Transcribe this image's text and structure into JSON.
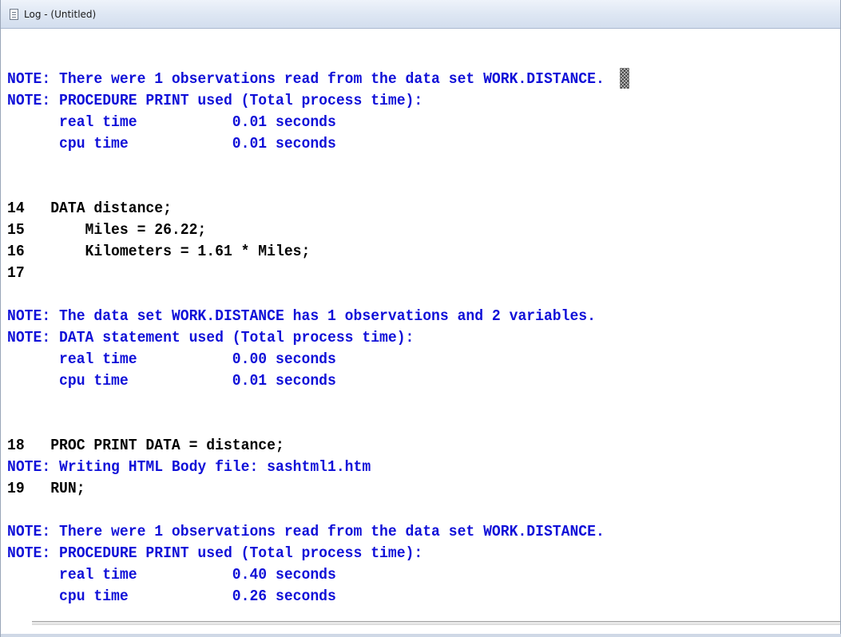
{
  "window": {
    "title": "Log - (Untitled)",
    "icon": "document-icon"
  },
  "colors": {
    "note": "#1010d8",
    "source": "#000000"
  },
  "log": {
    "lines": [
      {
        "kind": "blank",
        "text": ""
      },
      {
        "kind": "note",
        "text": "NOTE: There were 1 observations read from the data set WORK.DISTANCE."
      },
      {
        "kind": "note",
        "text": "NOTE: PROCEDURE PRINT used (Total process time):"
      },
      {
        "kind": "note",
        "text": "      real time           0.01 seconds"
      },
      {
        "kind": "note",
        "text": "      cpu time            0.01 seconds"
      },
      {
        "kind": "blank",
        "text": ""
      },
      {
        "kind": "blank",
        "text": ""
      },
      {
        "kind": "source",
        "text": "14   DATA distance;"
      },
      {
        "kind": "source",
        "text": "15       Miles = 26.22;"
      },
      {
        "kind": "source",
        "text": "16       Kilometers = 1.61 * Miles;"
      },
      {
        "kind": "source",
        "text": "17"
      },
      {
        "kind": "blank",
        "text": ""
      },
      {
        "kind": "note",
        "text": "NOTE: The data set WORK.DISTANCE has 1 observations and 2 variables."
      },
      {
        "kind": "note",
        "text": "NOTE: DATA statement used (Total process time):"
      },
      {
        "kind": "note",
        "text": "      real time           0.00 seconds"
      },
      {
        "kind": "note",
        "text": "      cpu time            0.01 seconds"
      },
      {
        "kind": "blank",
        "text": ""
      },
      {
        "kind": "blank",
        "text": ""
      },
      {
        "kind": "source",
        "text": "18   PROC PRINT DATA = distance;"
      },
      {
        "kind": "note",
        "text": "NOTE: Writing HTML Body file: sashtml1.htm"
      },
      {
        "kind": "source",
        "text": "19   RUN;"
      },
      {
        "kind": "blank",
        "text": ""
      },
      {
        "kind": "note",
        "text": "NOTE: There were 1 observations read from the data set WORK.DISTANCE."
      },
      {
        "kind": "note",
        "text": "NOTE: PROCEDURE PRINT used (Total process time):"
      },
      {
        "kind": "note",
        "text": "      real time           0.40 seconds"
      },
      {
        "kind": "note",
        "text": "      cpu time            0.26 seconds"
      }
    ]
  }
}
